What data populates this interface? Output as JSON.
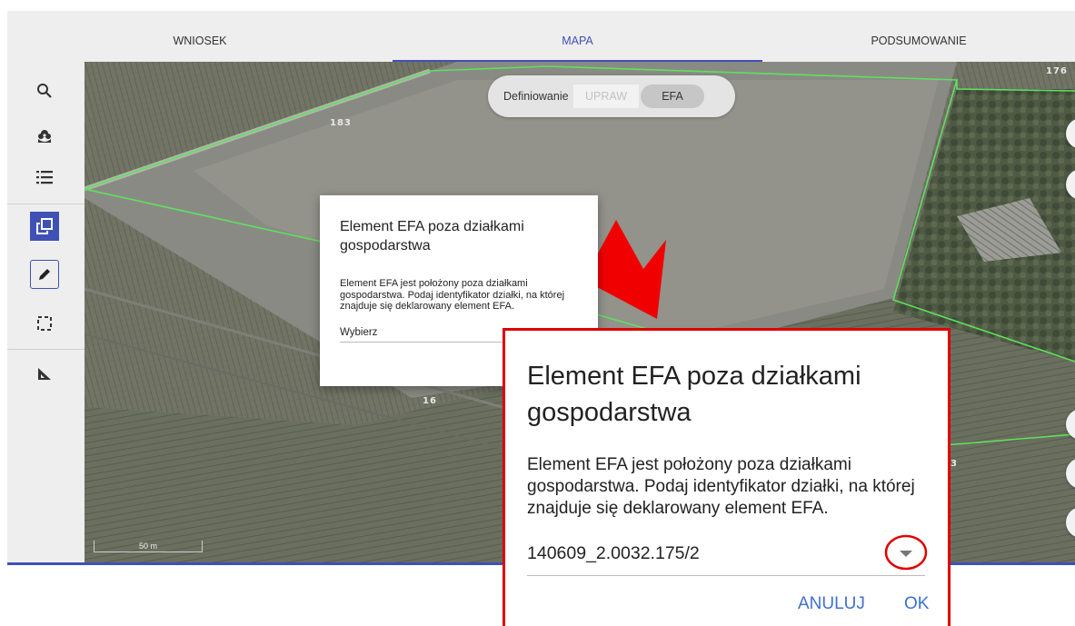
{
  "tabs": [
    {
      "label": "WNIOSEK",
      "active": false
    },
    {
      "label": "MAPA",
      "active": true
    },
    {
      "label": "PODSUMOWANIE",
      "active": false
    }
  ],
  "toolbar": {
    "icons": [
      "search-icon",
      "plant-icon",
      "list-icon",
      "copy-polygon-icon",
      "pencil-icon",
      "select-area-icon",
      "measure-icon"
    ]
  },
  "map": {
    "mode_toggle": {
      "label": "Definiowanie",
      "option_upraw": "UPRAW",
      "option_efa": "EFA",
      "selected": "EFA"
    },
    "parcel_labels": [
      "176",
      "183",
      "16",
      "3"
    ],
    "scale": "50 m"
  },
  "dialog_small": {
    "title": "Element EFA poza działkami gospodarstwa",
    "body": "Element EFA jest położony poza działkami gospodarstwa. Podaj identyfikator działki, na której znajduje się deklarowany element EFA.",
    "select_placeholder": "Wybierz"
  },
  "dialog_zoom": {
    "title": "Element EFA poza działkami gospodarstwa",
    "body": "Element EFA jest położony poza działkami gospodarstwa. Podaj identyfikator działki, na której znajduje się deklarowany element EFA.",
    "select_value": "140609_2.0032.175/2",
    "cancel_label": "ANULUJ",
    "ok_label": "OK"
  },
  "colors": {
    "accent": "#3f51b5",
    "highlight": "#e00000",
    "parcel_border": "#5fe05f",
    "button_text": "#3f6fd0"
  }
}
